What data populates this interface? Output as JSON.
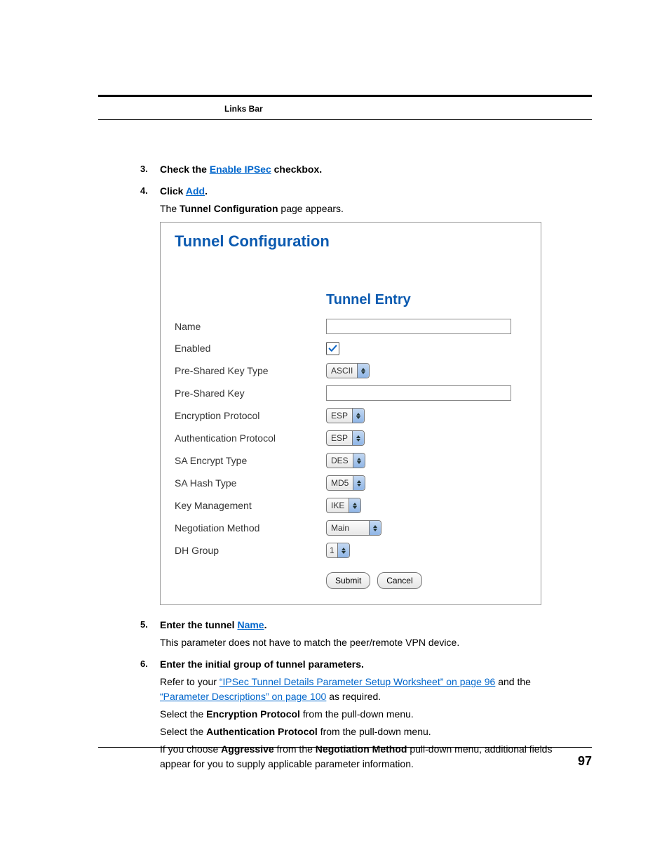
{
  "header": {
    "links_bar": "Links Bar"
  },
  "steps": {
    "s3": {
      "num": "3.",
      "pre": "Check the ",
      "link": "Enable IPSec",
      "post": " checkbox."
    },
    "s4": {
      "num": "4.",
      "pre": "Click ",
      "link": "Add",
      "post": ".",
      "sub_pre": "The ",
      "sub_bold": "Tunnel Configuration",
      "sub_post": " page appears."
    },
    "s5": {
      "num": "5.",
      "pre": "Enter the tunnel ",
      "link": "Name",
      "post": ".",
      "sub": "This parameter does not have to match the peer/remote VPN device."
    },
    "s6": {
      "num": "6.",
      "title": "Enter the initial group of tunnel parameters.",
      "l1_pre": "Refer to your ",
      "l1_link1": "“IPSec Tunnel Details Parameter Setup Worksheet” on page 96",
      "l1_mid": " and the ",
      "l1_link2": "“Parameter Descriptions” on page 100",
      "l1_post": " as required.",
      "l2_pre": "Select the ",
      "l2_bold": "Encryption Protocol",
      "l2_post": " from the pull-down menu.",
      "l3_pre": "Select the ",
      "l3_bold": "Authentication Protocol",
      "l3_post": " from the pull-down menu.",
      "l4_pre": "If you choose ",
      "l4_bold1": "Aggressive",
      "l4_mid": " from the ",
      "l4_bold2": "Negotiation Method",
      "l4_post": " pull-down menu, additional fields appear for you to supply applicable parameter information."
    }
  },
  "form": {
    "title": "Tunnel Configuration",
    "section": "Tunnel Entry",
    "labels": {
      "name": "Name",
      "enabled": "Enabled",
      "psk_type": "Pre-Shared Key Type",
      "psk": "Pre-Shared Key",
      "enc_proto": "Encryption Protocol",
      "auth_proto": "Authentication Protocol",
      "sa_encrypt": "SA Encrypt Type",
      "sa_hash": "SA Hash Type",
      "key_mgmt": "Key Management",
      "neg_method": "Negotiation Method",
      "dh_group": "DH Group"
    },
    "values": {
      "name": "",
      "enabled": true,
      "psk_type": "ASCII",
      "psk": "",
      "enc_proto": "ESP",
      "auth_proto": "ESP",
      "sa_encrypt": "DES",
      "sa_hash": "MD5",
      "key_mgmt": "IKE",
      "neg_method": "Main",
      "dh_group": "1"
    },
    "buttons": {
      "submit": "Submit",
      "cancel": "Cancel"
    }
  },
  "page_number": "97"
}
